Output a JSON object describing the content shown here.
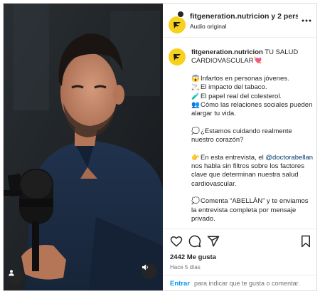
{
  "header": {
    "account_name": "fitgeneration.nutricion y 2 personas",
    "audio_label": "Audio original",
    "avatar_icon": "fitgeneration-logo-icon",
    "more_icon": "more-options-icon"
  },
  "caption": {
    "author": "fitgeneration.nutricion",
    "title": "TU SALUD CARDIOVASCULAR",
    "title_emoji": "💘",
    "bullets": [
      {
        "emoji": "😱",
        "text": "Infartos en personas jóvenes."
      },
      {
        "emoji": "🚬",
        "text": "El impacto del tabaco."
      },
      {
        "emoji": "🧪",
        "text": "El papel real del colesterol."
      },
      {
        "emoji": "👥",
        "text": "Cómo las relaciones sociales pueden alargar tu vida."
      }
    ],
    "question_emoji": "💭",
    "question": "¿Estamos cuidando realmente nuestro corazón?",
    "interview_emoji": "👉",
    "interview_prefix": "En esta entrevista, el",
    "mention": "@doctorabellan",
    "interview_suffix": "nos habla sin filtros sobre los factores clave que determinan nuestra salud cardiovascular.",
    "cta_emoji": "💭",
    "cta": "Comenta “ABELLÁN” y te enviamos la entrevista completa por mensaje privado."
  },
  "actions": {
    "like_icon": "heart-icon",
    "comment_icon": "comment-icon",
    "share_icon": "share-icon",
    "save_icon": "bookmark-icon",
    "likes": "2442 Me gusta",
    "time": "Hace 5 días"
  },
  "comment": {
    "login_label": "Entrar",
    "prompt": "para indicar que te gusta o comentar."
  },
  "media": {
    "user_icon": "user-tag-icon",
    "sound_icon": "sound-on-icon"
  }
}
